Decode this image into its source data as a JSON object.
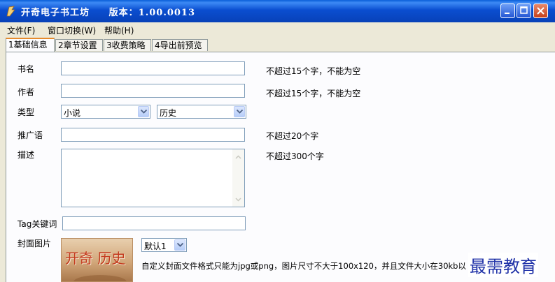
{
  "window": {
    "title": "开奇电子书工坊",
    "version": "版本：1.00.0013"
  },
  "menu": [
    "文件(F)",
    "窗口切换(W)",
    "帮助(H)"
  ],
  "tabs": [
    "1基础信息",
    "2章节设置",
    "3收费策略",
    "4导出前预览"
  ],
  "active_tab": 0,
  "form": {
    "book_name": {
      "label": "书名",
      "value": "",
      "hint": "不超过15个字，不能为空"
    },
    "author": {
      "label": "作者",
      "value": "",
      "hint": "不超过15个字，不能为空"
    },
    "type": {
      "label": "类型",
      "category": "小说",
      "subcategory": "历史"
    },
    "promo": {
      "label": "推广语",
      "value": "",
      "hint": "不超过20个字"
    },
    "description": {
      "label": "描述",
      "value": "",
      "hint": "不超过300个字"
    },
    "tags": {
      "label": "Tag关键词",
      "value": ""
    },
    "cover": {
      "label": "封面图片",
      "image_text": "开奇 历史",
      "select": "默认1",
      "hint": "自定义封面文件格式只能为jpg或png，图片尺寸不大于100x120，并且文件大小在30kb以"
    }
  },
  "watermark": "最需教育",
  "colors": {
    "titlebar": "#0a4ed0",
    "tab_accent": "#e68b2c",
    "input_border": "#7f9db9"
  }
}
